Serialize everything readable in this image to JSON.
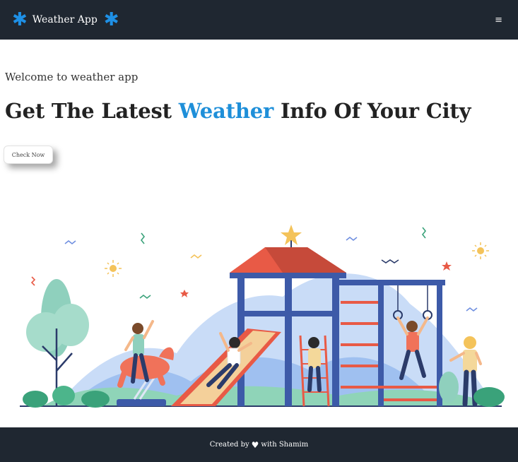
{
  "navbar": {
    "brand_title": "Weather App",
    "brand_icon_left": "✱",
    "brand_icon_right": "✱",
    "menu_icon": "≡"
  },
  "hero": {
    "welcome_text": "Welcome to weather app",
    "headline_before": "Get The Latest ",
    "headline_accent": "Weather",
    "headline_after": " Info Of Your City",
    "check_button": "Check Now"
  },
  "footer": {
    "created_by": "Created by",
    "heart_icon": "♥",
    "with_author": "with Shamim"
  },
  "colors": {
    "navbar_bg": "#1f2731",
    "accent": "#1e8fd9",
    "footer_bg": "#1f2731"
  }
}
